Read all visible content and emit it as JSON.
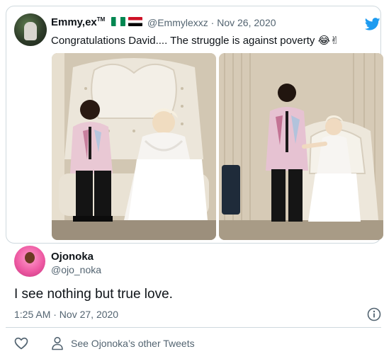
{
  "quoted_tweet": {
    "display_name": "Emmy",
    "name_suffix": "ex",
    "name_superscript": "TM",
    "flags": [
      "flag-nigeria-icon",
      "flag-egypt-icon"
    ],
    "handle": "@Emmylexxz",
    "separator": "·",
    "date": "Nov 26, 2020",
    "text": "Congratulations David.... The struggle is against poverty",
    "emojis": [
      "😂",
      "✌"
    ]
  },
  "reply": {
    "display_name": "Ojonoka",
    "handle": "@ojo_noka",
    "text": "I see nothing but true love.",
    "timestamp": "1:25 AM · Nov 27, 2020"
  },
  "actions": {
    "see_other_tweets": "See Ojonoka’s other Tweets"
  },
  "colors": {
    "twitter_blue": "#1d9bf0",
    "secondary_text": "#536471",
    "border": "#cfd9de"
  }
}
